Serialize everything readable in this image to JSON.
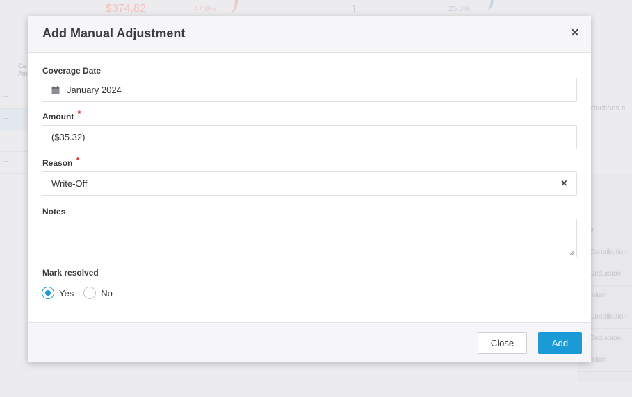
{
  "background": {
    "amount": "$374.82",
    "pct_a": "47.8%",
    "count": "1",
    "pct_b": "25.0%",
    "left_header": "Ca\nAm",
    "left_rows": [
      "...",
      "...",
      "...",
      "..."
    ],
    "right_text": "ductions c",
    "right_table_header": "e",
    "right_table_rows": [
      "Contribution",
      "Deduction",
      "mium",
      "Contribution",
      "Deduction",
      "mium"
    ]
  },
  "modal": {
    "title": "Add Manual Adjustment",
    "close_icon": "close-icon",
    "fields": {
      "coverage_date": {
        "label": "Coverage Date",
        "value": "January 2024",
        "icon": "calendar-icon"
      },
      "amount": {
        "label": "Amount",
        "required_mark": "*",
        "value": "($35.32)"
      },
      "reason": {
        "label": "Reason",
        "required_mark": "*",
        "value": "Write-Off",
        "clear_icon": "clear-icon"
      },
      "notes": {
        "label": "Notes",
        "value": ""
      },
      "mark_resolved": {
        "label": "Mark resolved",
        "options": [
          {
            "label": "Yes",
            "selected": true
          },
          {
            "label": "No",
            "selected": false
          }
        ]
      }
    },
    "footer": {
      "close_label": "Close",
      "add_label": "Add"
    }
  },
  "colors": {
    "accent": "#1a9ad6",
    "required": "#d62f2f"
  }
}
